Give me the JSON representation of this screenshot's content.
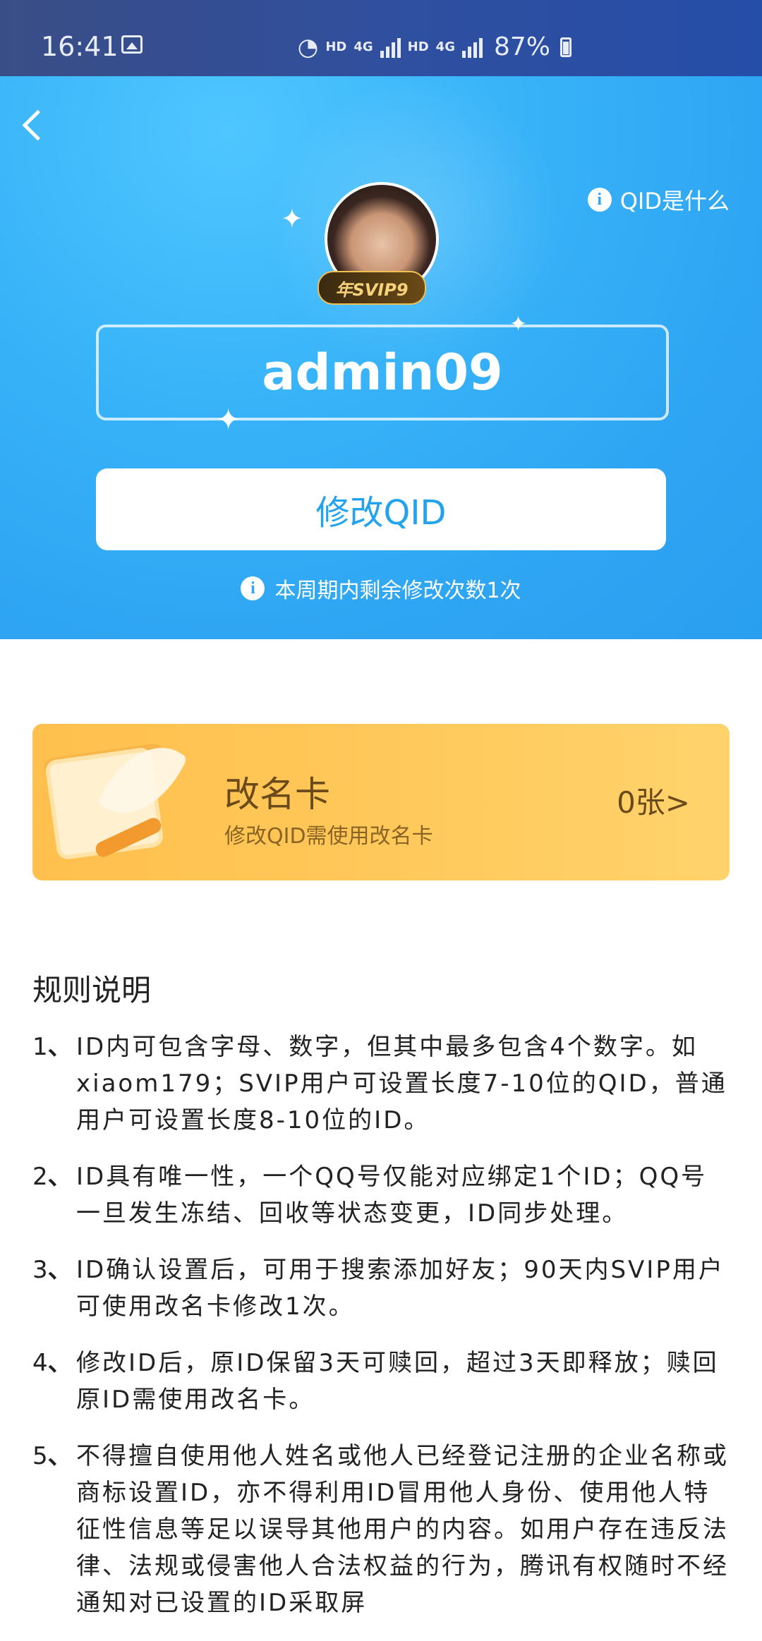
{
  "status_bar": {
    "time": "16:41",
    "network_1": "HD",
    "network_1_type": "4G",
    "network_2": "HD",
    "network_2_type": "4G",
    "battery": "87%"
  },
  "header": {
    "help_label": "QID是什么",
    "svip_badge": "年SVIP9",
    "qid_value": "admin09",
    "modify_button": "修改QID",
    "remaining_note": "本周期内剩余修改次数1次"
  },
  "rename_card": {
    "title": "改名卡",
    "subtitle": "修改QID需使用改名卡",
    "count": "0张>"
  },
  "rules": {
    "title": "规则说明",
    "items": [
      {
        "num": "1",
        "text": "ID内可包含字母、数字，但其中最多包含4个数字。如xiaom179；SVIP用户可设置长度7-10位的QID，普通用户可设置长度8-10位的ID。"
      },
      {
        "num": "2",
        "text": "ID具有唯一性，一个QQ号仅能对应绑定1个ID；QQ号一旦发生冻结、回收等状态变更，ID同步处理。"
      },
      {
        "num": "3",
        "text": "ID确认设置后，可用于搜索添加好友；90天内SVIP用户可使用改名卡修改1次。"
      },
      {
        "num": "4",
        "text": "修改ID后，原ID保留3天可赎回，超过3天即释放；赎回原ID需使用改名卡。"
      },
      {
        "num": "5",
        "text": "不得擅自使用他人姓名或他人已经登记注册的企业名称或商标设置ID，亦不得利用ID冒用他人身份、使用他人特征性信息等足以误导其他用户的内容。如用户存在违反法律、法规或侵害他人合法权益的行为，腾讯有权随时不经通知对已设置的ID采取屏"
      }
    ]
  }
}
